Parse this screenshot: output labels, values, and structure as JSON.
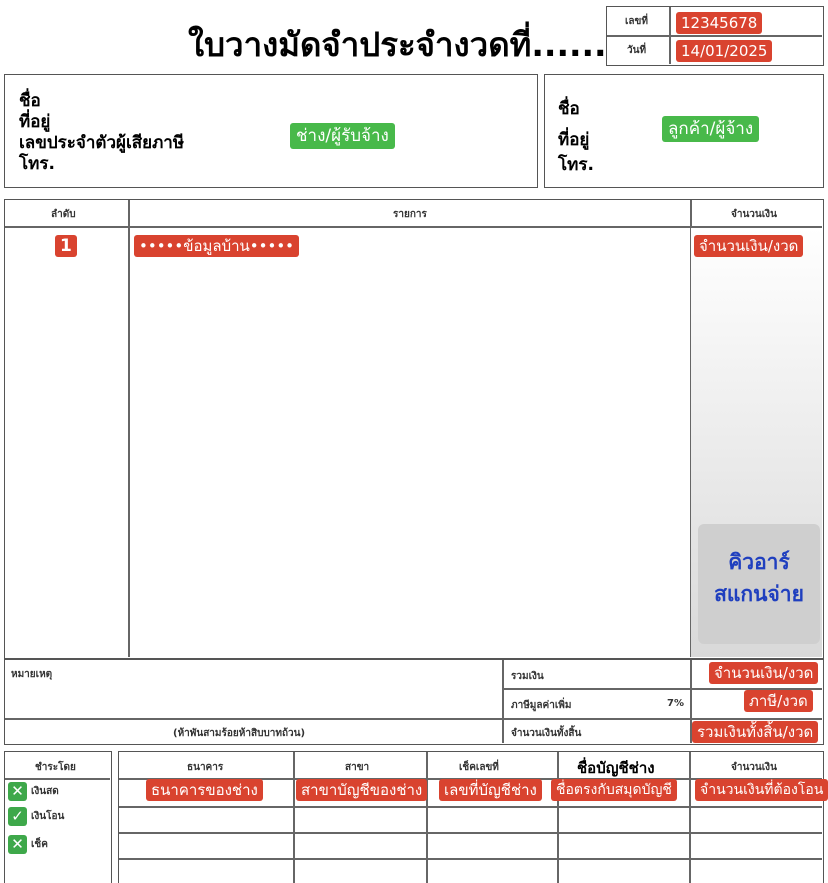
{
  "header": {
    "title": "ใบวางมัดจำประจำงวดที่......",
    "doc_no_label": "เลขที่",
    "doc_no_value": "12345678",
    "date_label": "วันที่",
    "date_value": "14/01/2025"
  },
  "contractor": {
    "name_label": "ชื่อ",
    "address_label": "ที่อยู่",
    "taxid_label": "เลขประจำตัวผู้เสียภาษี",
    "phone_label": "โทร.",
    "tag": "ช่าง/ผู้รับจ้าง"
  },
  "customer": {
    "name_label": "ชื่อ",
    "address_label": "ที่อยู่",
    "phone_label": "โทร.",
    "tag": "ลูกค้า/ผู้จ้าง"
  },
  "items_table": {
    "col_no": "ลำดับ",
    "col_desc": "รายการ",
    "col_amount": "จำนวนเงิน",
    "row_no": "1",
    "row_desc": "•••••ข้อมูลบ้าน•••••",
    "row_amount": "จำนวนเงิน/งวด",
    "qr_text_1": "คิวอาร์",
    "qr_text_2": "สแกนจ่าย"
  },
  "summary": {
    "remark_label": "หมายเหตุ",
    "subtotal_label": "รวมเงิน",
    "subtotal_value": "จำนวนเงิน/งวด",
    "vat_label": "ภาษีมูลค่าเพิ่ม",
    "vat_rate": "7%",
    "vat_value": "ภาษี/งวด",
    "amount_words": "(ห้าพันสามร้อยห้าสิบบาทถ้วน)",
    "total_label": "จำนวนเงินทั้งสิ้น",
    "total_value": "รวมเงินทั้งสิ้น/งวด"
  },
  "payment": {
    "col_method": "ชำระโดย",
    "col_bank": "ธนาคาร",
    "col_branch": "สาขา",
    "col_account": "เช็คเลขที่",
    "col_account_name": "ชื่อบัญชีช่าง",
    "col_amount": "จำนวนเงิน",
    "method_cash": "เงินสด",
    "method_transfer": "เงินโอน",
    "method_cheque": "เช็ค",
    "bank_value": "ธนาคารของช่าง",
    "branch_value": "สาขาบัญชีของช่าง",
    "account_value": "เลขที่บัญชีช่าง",
    "account_name_value": "ชื่อตรงกับสมุดบัญชี",
    "amount_value": "จำนวนเงินที่ต้องโอน",
    "cash_icon": "x-mark",
    "transfer_icon": "check-mark",
    "cheque_icon": "x-mark"
  },
  "colors": {
    "red_tag": "#d9432f",
    "green_tag": "#48b94a",
    "qr_text": "#1f3fbf"
  }
}
